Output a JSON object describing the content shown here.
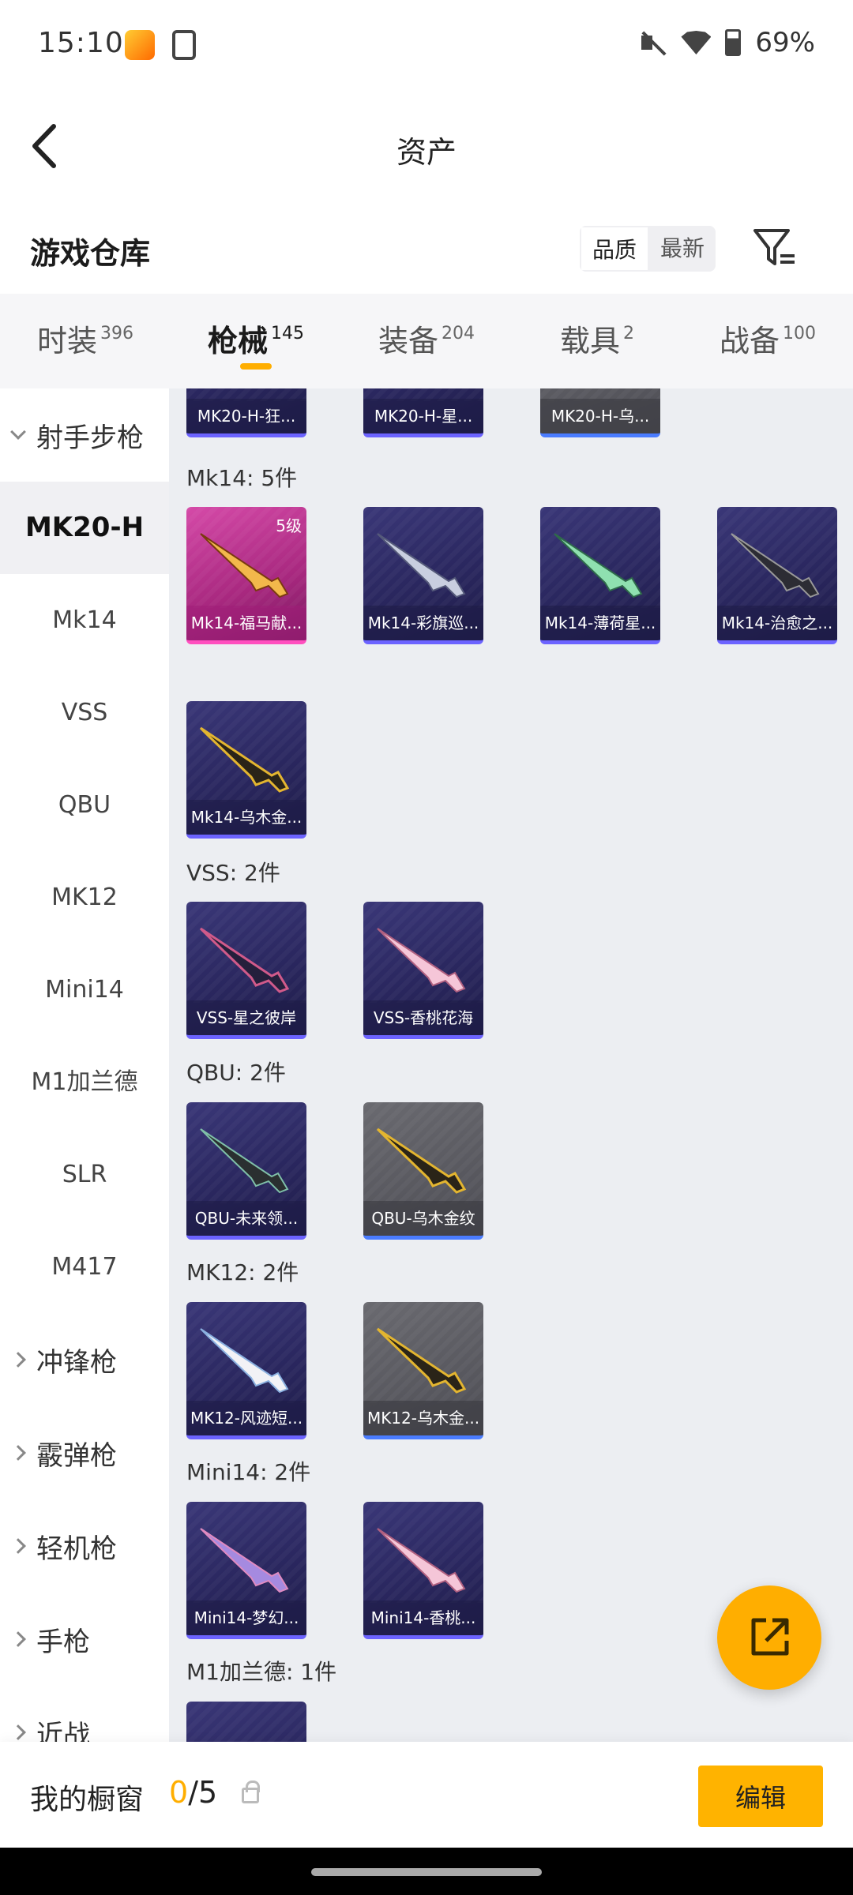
{
  "status_bar": {
    "time": "15:10",
    "battery": "69%"
  },
  "header": {
    "title": "资产"
  },
  "warehouse": {
    "title": "游戏仓库",
    "sort_options": [
      "品质",
      "最新"
    ],
    "active_sort": "品质"
  },
  "tabs": [
    {
      "label": "时装",
      "count": "396"
    },
    {
      "label": "枪械",
      "count": "145"
    },
    {
      "label": "装备",
      "count": "204"
    },
    {
      "label": "载具",
      "count": "2"
    },
    {
      "label": "战备",
      "count": "100"
    }
  ],
  "sidebar": {
    "group_open": "射手步枪",
    "items": [
      "MK20-H",
      "Mk14",
      "VSS",
      "QBU",
      "MK12",
      "Mini14",
      "M1加兰德",
      "SLR",
      "M417"
    ],
    "groups_closed": [
      "冲锋枪",
      "霰弹枪",
      "轻机枪",
      "手枪",
      "近战"
    ]
  },
  "content": {
    "top_partial_cards": [
      "MK20-H-狂...",
      "MK20-H-星...",
      "MK20-H-乌..."
    ],
    "sections": [
      {
        "title": "Mk14: 5件",
        "items": [
          {
            "name": "Mk14-福马献...",
            "level": "5级"
          },
          {
            "name": "Mk14-彩旗巡..."
          },
          {
            "name": "Mk14-薄荷星..."
          },
          {
            "name": "Mk14-治愈之..."
          },
          {
            "name": "Mk14-乌木金..."
          }
        ]
      },
      {
        "title": "VSS: 2件",
        "items": [
          {
            "name": "VSS-星之彼岸"
          },
          {
            "name": "VSS-香桃花海"
          }
        ]
      },
      {
        "title": "QBU: 2件",
        "items": [
          {
            "name": "QBU-未来领..."
          },
          {
            "name": "QBU-乌木金纹"
          }
        ]
      },
      {
        "title": "MK12: 2件",
        "items": [
          {
            "name": "MK12-风迹短..."
          },
          {
            "name": "MK12-乌木金..."
          }
        ]
      },
      {
        "title": "Mini14: 2件",
        "items": [
          {
            "name": "Mini14-梦幻..."
          },
          {
            "name": "Mini14-香桃..."
          }
        ]
      },
      {
        "title": "M1加兰德: 1件",
        "items": []
      }
    ]
  },
  "bottom_bar": {
    "label": "我的橱窗",
    "current": "0",
    "total": "/5",
    "edit_label": "编辑"
  },
  "colors": {
    "accent": "#ffae00",
    "card_purple": "#2a275f",
    "card_pink": "#a8287f",
    "card_gray": "#4d4d54"
  }
}
